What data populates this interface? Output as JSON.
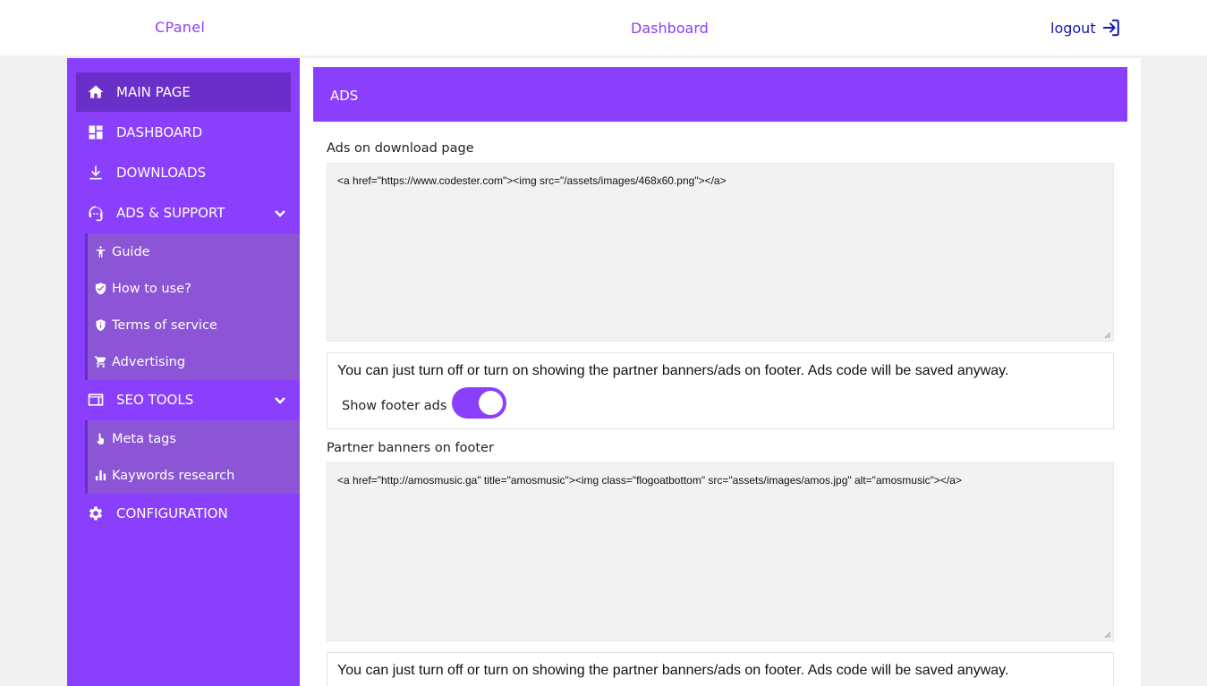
{
  "header": {
    "brand": "CPanel",
    "title": "Dashboard",
    "logout_label": "logout"
  },
  "sidebar": {
    "items": [
      {
        "label": "MAIN PAGE",
        "icon": "home-icon"
      },
      {
        "label": "DASHBOARD",
        "icon": "dashboard-icon"
      },
      {
        "label": "DOWNLOADS",
        "icon": "download-icon"
      },
      {
        "label": "ADS & SUPPORT",
        "icon": "support-agent-icon"
      },
      {
        "label": "SEO TOOLS",
        "icon": "web-window-icon"
      },
      {
        "label": "CONFIGURATION",
        "icon": "gear-icon"
      }
    ],
    "ads_support_sub": [
      {
        "label": "Guide",
        "icon": "accessibility-icon"
      },
      {
        "label": "How to use?",
        "icon": "verified-check-icon"
      },
      {
        "label": "Terms of service",
        "icon": "shield-icon"
      },
      {
        "label": "Advertising",
        "icon": "cart-icon"
      }
    ],
    "seo_sub": [
      {
        "label": "Meta tags",
        "icon": "touch-icon"
      },
      {
        "label": "Kaywords research",
        "icon": "bar-chart-icon"
      }
    ]
  },
  "main": {
    "card_title": "ADS",
    "download_ads_label": "Ads on download page",
    "download_ads_code": "<a href=\"https://www.codester.com\"><img src=\"/assets/images/468x60.png\"></a>",
    "footer_note_1": "You can just turn off or turn on showing the partner banners/ads on footer. Ads code will be saved anyway.",
    "show_footer_ads_label": "Show footer ads",
    "partner_label": "Partner banners on footer",
    "partner_code": "<a href=\"http://amosmusic.ga\" title=\"amosmusic\"><img class=\"flogoatbottom\" src=\"assets/images/amos.jpg\" alt=\"amosmusic\"></a>",
    "footer_note_2": "You can just turn off or turn on showing the partner banners/ads on footer. Ads code will be saved anyway."
  },
  "colors": {
    "accent": "#8a3ffc",
    "accent_dark": "#6a2ec9",
    "submenu": "#8b55d6",
    "logout": "#1a1aa8"
  }
}
